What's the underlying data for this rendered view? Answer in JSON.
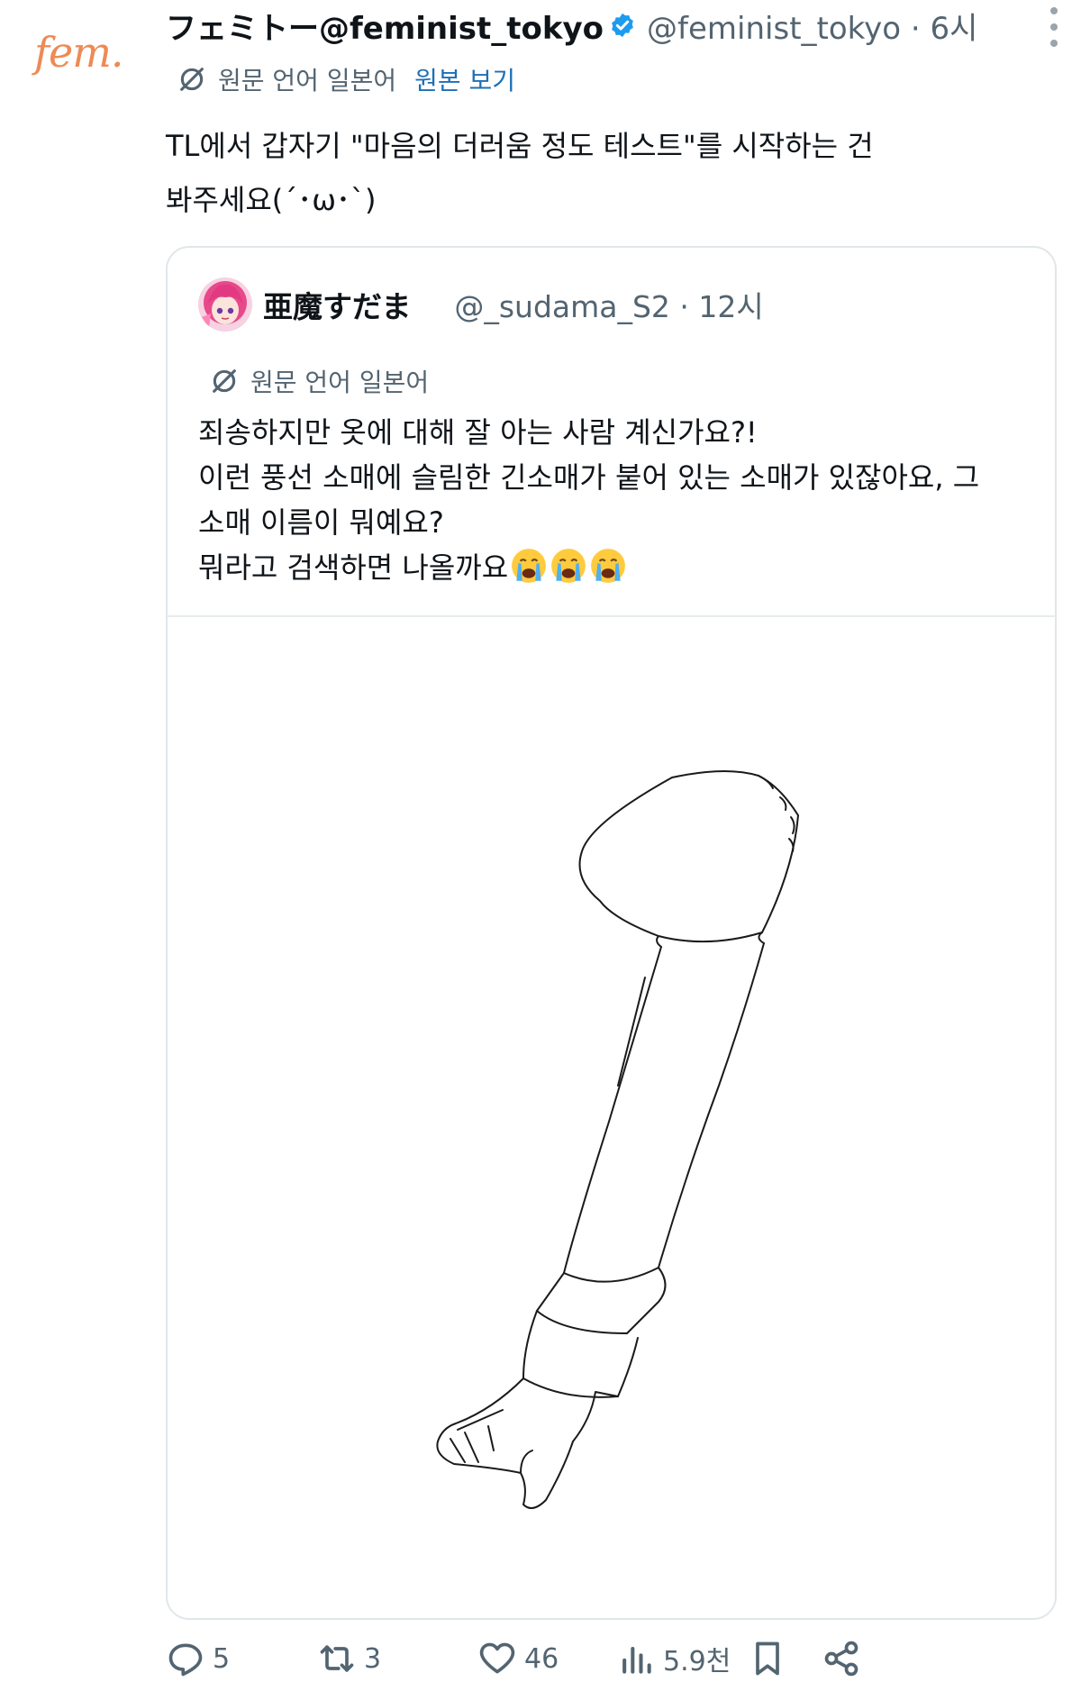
{
  "tweet": {
    "avatar_text": "fem.",
    "display_name": "フェミトー@feminist_tokyo",
    "handle_time": "@feminist_tokyo · 6시",
    "translate_label": "원문 언어 일본어",
    "show_original": "원본 보기",
    "text_line1": "TL에서 갑자기 \"마음의 더러움 정도 테스트\"를 시작하는 건",
    "text_line2": "봐주세요(´･ω･`)"
  },
  "quote": {
    "display_name": "亜魔すだま",
    "handle_time": "@_sudama_S2 · 12시",
    "translate_label": "원문 언어 일본어",
    "line1": "죄송하지만 옷에 대해 잘 아는 사람 계신가요?!",
    "line2": "이런 풍선 소매에 슬림한 긴소매가 붙어 있는 소매가 있잖아요, 그",
    "line3": "소매 이름이 뭐예요?",
    "line4": "뭐라고 검색하면 나올까요"
  },
  "actions": {
    "replies": "5",
    "retweets": "3",
    "likes": "46",
    "views": "5.9천"
  },
  "colors": {
    "logo": "#ee8a55",
    "verified": "#1d9bf0",
    "link": "#1d6fb6",
    "muted": "#536471"
  }
}
